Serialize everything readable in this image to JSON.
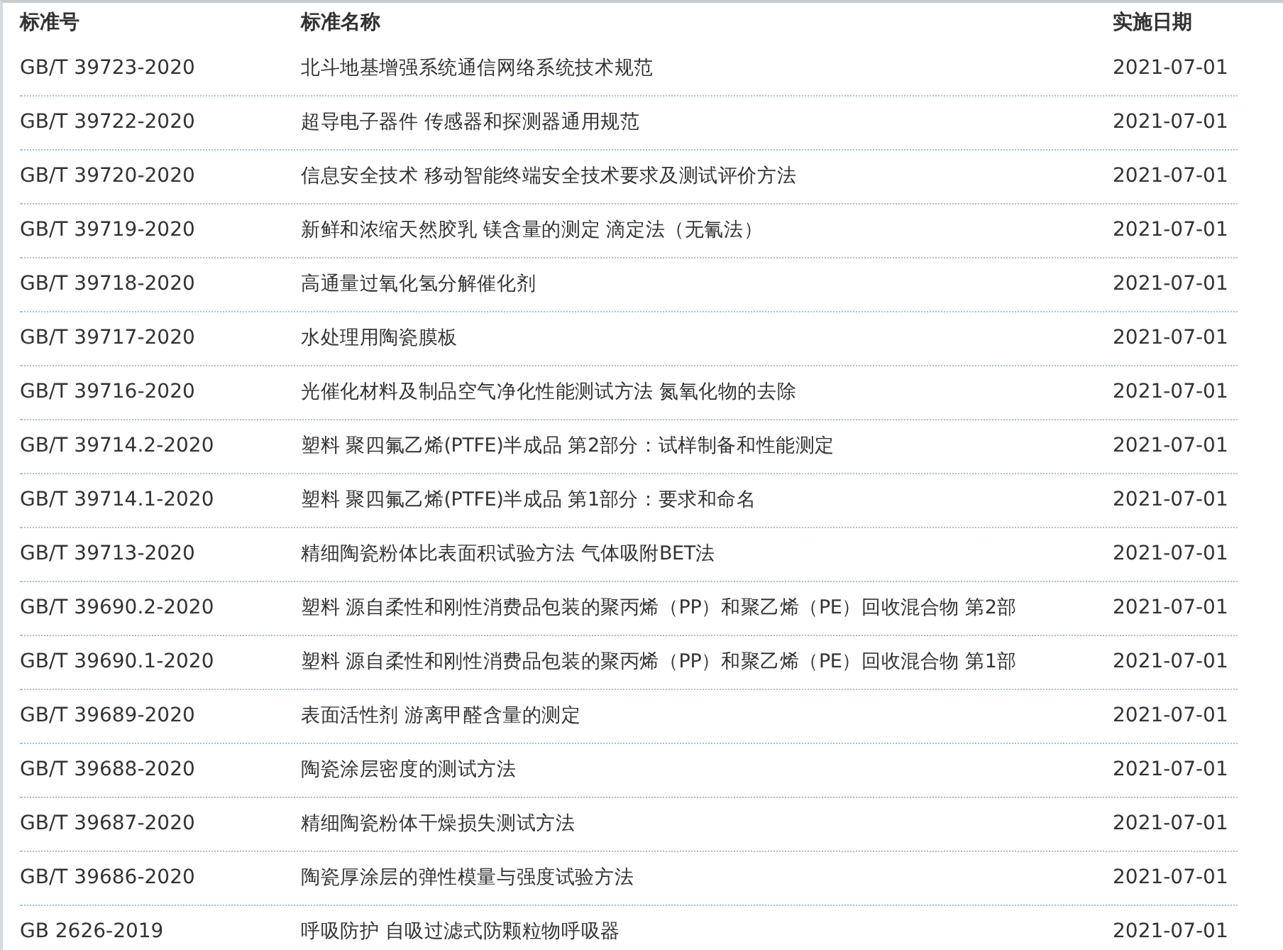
{
  "table": {
    "columns": [
      "标准号",
      "标准名称",
      "实施日期"
    ],
    "rows": [
      [
        "GB/T 39723-2020",
        "北斗地基增强系统通信网络系统技术规范",
        "2021-07-01"
      ],
      [
        "GB/T 39722-2020",
        "超导电子器件 传感器和探测器通用规范",
        "2021-07-01"
      ],
      [
        "GB/T 39720-2020",
        "信息安全技术 移动智能终端安全技术要求及测试评价方法",
        "2021-07-01"
      ],
      [
        "GB/T 39719-2020",
        "新鲜和浓缩天然胶乳 镁含量的测定 滴定法（无氰法）",
        "2021-07-01"
      ],
      [
        "GB/T 39718-2020",
        "高通量过氧化氢分解催化剂",
        "2021-07-01"
      ],
      [
        "GB/T 39717-2020",
        "水处理用陶瓷膜板",
        "2021-07-01"
      ],
      [
        "GB/T 39716-2020",
        "光催化材料及制品空气净化性能测试方法 氮氧化物的去除",
        "2021-07-01"
      ],
      [
        "GB/T 39714.2-2020",
        "塑料 聚四氟乙烯(PTFE)半成品 第2部分：试样制备和性能测定",
        "2021-07-01"
      ],
      [
        "GB/T 39714.1-2020",
        "塑料 聚四氟乙烯(PTFE)半成品 第1部分：要求和命名",
        "2021-07-01"
      ],
      [
        "GB/T 39713-2020",
        "精细陶瓷粉体比表面积试验方法 气体吸附BET法",
        "2021-07-01"
      ],
      [
        "GB/T 39690.2-2020",
        "塑料 源自柔性和刚性消费品包装的聚丙烯（PP）和聚乙烯（PE）回收混合物 第2部",
        "2021-07-01"
      ],
      [
        "GB/T 39690.1-2020",
        "塑料 源自柔性和刚性消费品包装的聚丙烯（PP）和聚乙烯（PE）回收混合物 第1部",
        "2021-07-01"
      ],
      [
        "GB/T 39689-2020",
        "表面活性剂 游离甲醛含量的测定",
        "2021-07-01"
      ],
      [
        "GB/T 39688-2020",
        "陶瓷涂层密度的测试方法",
        "2021-07-01"
      ],
      [
        "GB/T 39687-2020",
        "精细陶瓷粉体干燥损失测试方法",
        "2021-07-01"
      ],
      [
        "GB/T 39686-2020",
        "陶瓷厚涂层的弹性模量与强度试验方法",
        "2021-07-01"
      ],
      [
        "GB 2626-2019",
        "呼吸防护 自吸过滤式防颗粒物呼吸器",
        "2021-07-01"
      ]
    ]
  }
}
